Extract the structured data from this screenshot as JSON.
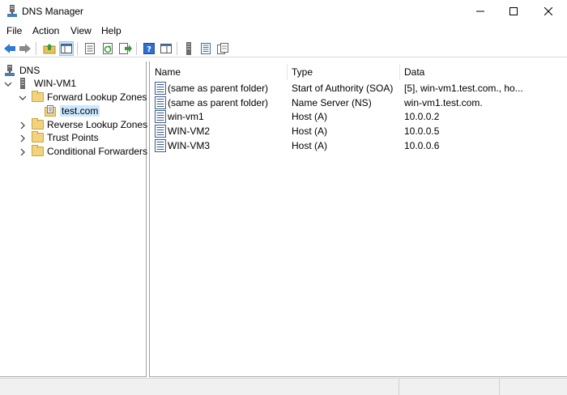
{
  "window": {
    "title": "DNS Manager",
    "icon": "dns-manager-icon"
  },
  "menu": {
    "items": [
      "File",
      "Action",
      "View",
      "Help"
    ]
  },
  "toolbar": {
    "buttons": [
      "back-icon",
      "forward-icon",
      "up-folder-icon",
      "show-hide-tree-icon",
      "properties-icon",
      "refresh-icon",
      "export-list-icon",
      "help-icon",
      "show-console-tree-icon",
      "server-icon",
      "zone-icon",
      "copy-icon"
    ]
  },
  "tree": {
    "root": "DNS",
    "server": "WIN-VM1",
    "forward_zones": "Forward Lookup Zones",
    "zone": "test.com",
    "reverse_zones": "Reverse Lookup Zones",
    "trust_points": "Trust Points",
    "conditional_forwarders": "Conditional Forwarders"
  },
  "list": {
    "columns": [
      "Name",
      "Type",
      "Data"
    ],
    "rows": [
      {
        "name": "(same as parent folder)",
        "type": "Start of Authority (SOA)",
        "data": "[5], win-vm1.test.com., ho..."
      },
      {
        "name": "(same as parent folder)",
        "type": "Name Server (NS)",
        "data": "win-vm1.test.com."
      },
      {
        "name": "win-vm1",
        "type": "Host (A)",
        "data": "10.0.0.2"
      },
      {
        "name": "WIN-VM2",
        "type": "Host (A)",
        "data": "10.0.0.5"
      },
      {
        "name": "WIN-VM3",
        "type": "Host (A)",
        "data": "10.0.0.6"
      }
    ]
  },
  "colors": {
    "selection": "#cce8ff",
    "toolbar_active": "#cce4f7",
    "folder": "#f2d27a",
    "status_bar": "#f0f0f0"
  }
}
